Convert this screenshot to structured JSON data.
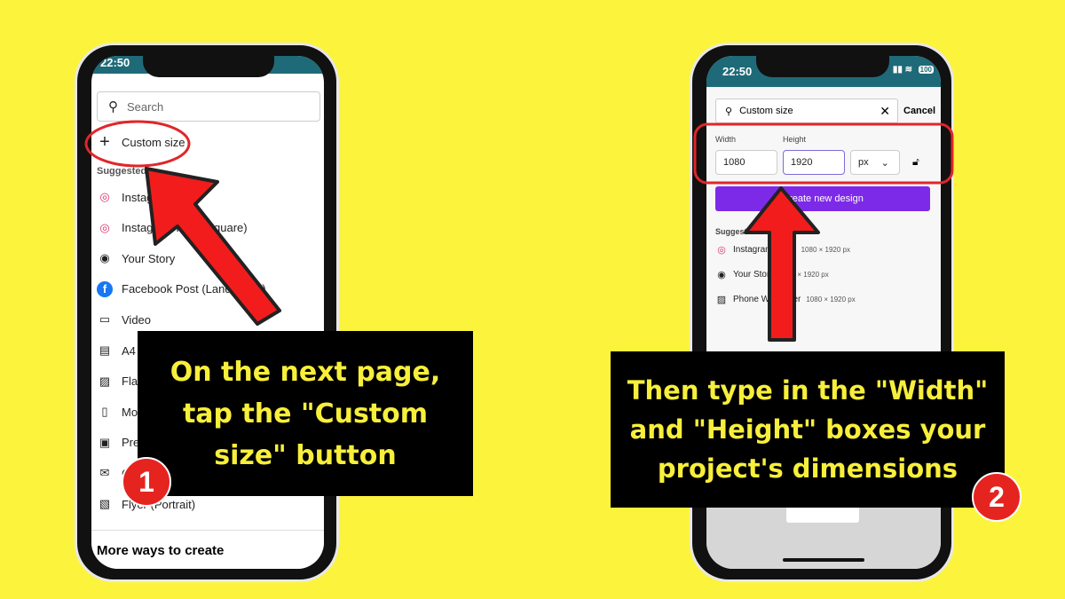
{
  "left_phone": {
    "time": "22:50",
    "search_placeholder": "Search",
    "custom_size": "Custom size",
    "suggested": "Suggested",
    "items": [
      {
        "label": "Instagram Post",
        "icon": "instagram-icon"
      },
      {
        "label": "Instagram Post (Square)",
        "icon": "instagram-icon"
      },
      {
        "label": "Your Story",
        "icon": "camera-icon"
      },
      {
        "label": "Facebook Post (Landscape)",
        "icon": "facebook-icon"
      },
      {
        "label": "Video",
        "icon": "video-icon"
      },
      {
        "label": "A4 Document",
        "icon": "document-icon"
      },
      {
        "label": "Flashcard",
        "icon": "image-icon"
      },
      {
        "label": "Mobile Video",
        "icon": "mobile-icon"
      },
      {
        "label": "Presentation",
        "icon": "presentation-icon"
      },
      {
        "label": "Card",
        "icon": "envelope-icon"
      },
      {
        "label": "Flyer (Portrait)",
        "icon": "flyer-icon"
      }
    ],
    "more_ways": "More ways to create"
  },
  "right_phone": {
    "time": "22:50",
    "battery": "100",
    "search_value": "Custom size",
    "cancel": "Cancel",
    "width_label": "Width",
    "height_label": "Height",
    "width_value": "1080",
    "height_value": "1920",
    "unit": "px",
    "create_button": "Create new design",
    "suggested": "Suggested",
    "items": [
      {
        "label": "Instagram Story",
        "size": "1080 × 1920 px",
        "icon": "instagram-icon"
      },
      {
        "label": "Your Story",
        "size": "1080 × 1920 px",
        "icon": "camera-icon"
      },
      {
        "label": "Phone Wallpaper",
        "size": "1080 × 1920 px",
        "icon": "wallpaper-icon"
      }
    ]
  },
  "captions": {
    "step1": "On the next page, tap the \"Custom size\" button",
    "step2": "Then type in the \"Width\" and \"Height\" boxes your project's dimensions"
  },
  "badges": {
    "step1": "1",
    "step2": "2"
  },
  "colors": {
    "background": "#fcf43c",
    "accent": "#7d2ae8",
    "arrow": "#f21c1c",
    "caption_text": "#f7ef3a"
  }
}
